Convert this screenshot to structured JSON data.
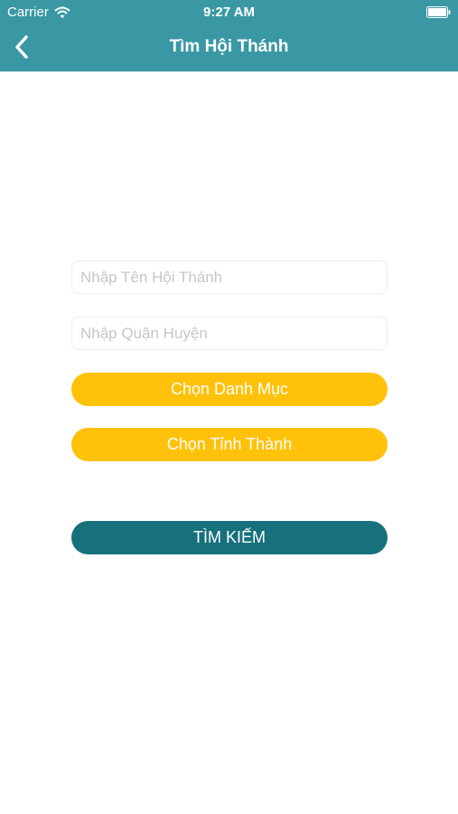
{
  "status_bar": {
    "carrier": "Carrier",
    "time": "9:27 AM"
  },
  "nav": {
    "title": "Tìm Hội Thánh",
    "back_icon": "chevron-left-icon"
  },
  "form": {
    "church_name_placeholder": "Nhập Tên Hội Thánh",
    "district_placeholder": "Nhập Quận Huyện",
    "category_button": "Chọn Danh Mục",
    "province_button": "Chọn Tỉnh Thành",
    "search_button": "TÌM KIẾM"
  },
  "colors": {
    "header": "#3a98a4",
    "yellow_button": "#ffc10a",
    "search_button": "#17717d",
    "background": "#ffffff"
  }
}
